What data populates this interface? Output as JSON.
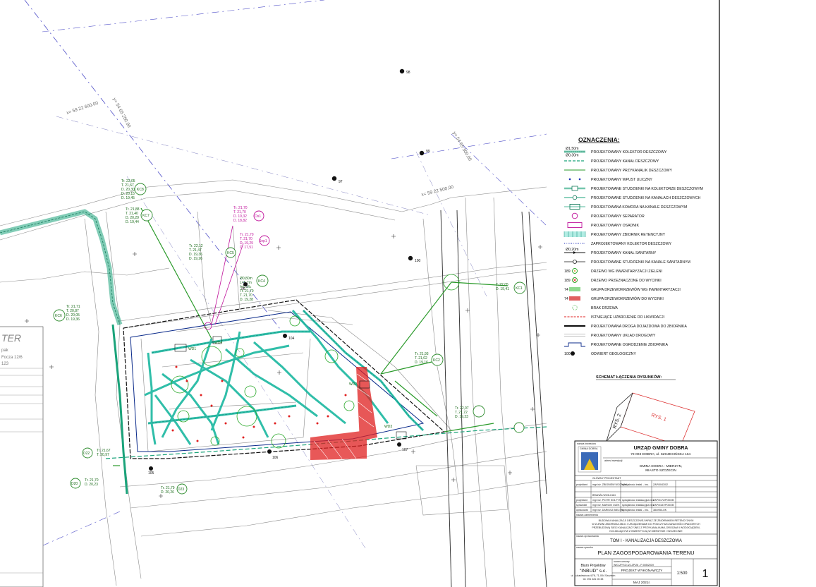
{
  "legend": {
    "title": "OZNACZENIA:",
    "items": [
      {
        "symbol": "collector",
        "top": "Ø1,50m",
        "bottom": "Ø0,30m",
        "label": "PROJEKTOWANY KOLEKTOR DESZCZOWY"
      },
      {
        "symbol": "channel",
        "label": "PROJEKTOWANY KANAŁ DESZCZOWY"
      },
      {
        "symbol": "connector",
        "label": "PROJEKTOWANY PRZYKANALIK DESZCZOWY"
      },
      {
        "symbol": "inlet",
        "label": "PROJEKTOWANY WPUST ULICZNY"
      },
      {
        "symbol": "well-collector",
        "label": "PROJEKTOWANE STUDZIENKI NA KOLEKTORZE DESZCZOWYM"
      },
      {
        "symbol": "well-channel",
        "label": "PROJEKTOWANE STUDZIENKI NA KANAŁACH DESZCZOWYCH"
      },
      {
        "symbol": "chamber",
        "label": "PROJEKTOWANA KOMORA NA KANALE DESZCZOWYM"
      },
      {
        "symbol": "separator",
        "label": "PROJEKTOWANY SEPARATOR"
      },
      {
        "symbol": "settler",
        "label": "PROJEKTOWANY OSADNIK"
      },
      {
        "symbol": "tank",
        "label": "PROJEKTOWANY ZBIORNIK RETENCYJNY"
      },
      {
        "symbol": "designed-collector",
        "label": "ZAPROJEKTOWANY KOLEKTOR DESZCZOWY"
      },
      {
        "symbol": "sanitary",
        "top": "Ø0,20m",
        "label": "PROJEKTOWANY KANAŁ SANITARNY"
      },
      {
        "symbol": "sanitary-well",
        "label": "PROJEKTOWANE STUDZIENKI NA KANALE SANITARNYM"
      },
      {
        "symbol": "tree",
        "num": "189",
        "label": "DRZEWO WG INWENTARYZACJI ZIELENI"
      },
      {
        "symbol": "tree-cut",
        "num": "189",
        "label": "DRZEWO PRZEZNACZONE DO WYCINKI"
      },
      {
        "symbol": "shrub",
        "num": "74",
        "label": "GRUPA DRZEWOKRZEWÓW WG INWENTARYZACJI"
      },
      {
        "symbol": "shrub-cut",
        "num": "74",
        "label": "GRUPA DRZEWOKRZEWÓW DO WYCINKI"
      },
      {
        "symbol": "no-tree",
        "label": "BRAK DRZEWA"
      },
      {
        "symbol": "to-remove",
        "label": "ISTNIEJĄCE UZBROJENIE DO LIKWIDACJI"
      },
      {
        "symbol": "road",
        "label": "PROJEKTOWANA DROGA DOJAZDOWA DO ZBIORNIKA"
      },
      {
        "symbol": "road-layout",
        "label": "PROJEKTOWANY UKŁAD DROGOWY"
      },
      {
        "symbol": "fence",
        "label": "PROJEKTOWANE OGRODZENIE ZBIORNIKA"
      },
      {
        "symbol": "geo",
        "num": "100",
        "label": "ODWIERT GEOLOGICZNY"
      }
    ]
  },
  "schemat": {
    "title": "SCHEMAT ŁĄCZENIA RYSUNKÓW:",
    "rys1": "RYS. 1",
    "rys2": "RYS. 2"
  },
  "title_block": {
    "investor_label": "nazwa inwestora",
    "logo_text": "GMINA DOBRA",
    "investor_name": "URZĄD GMINY DOBRA",
    "investor_address": "72-003 DOBRA; ul. SZCZECIŃSKA 16A",
    "object_label": "adres inwestycji",
    "location_1": "GMINA DOBRA - MIERZYN,",
    "location_2": "MIASTO SZCZECIN",
    "main_designer_header": "GŁÓWNY PROJEKTANT",
    "main_role": "projektant",
    "main_name": "mgr inż. ZBIGNIEW WOŹNIAK",
    "main_spec": "specjalność instal. - ins.",
    "main_no": "ZAP/0043/02",
    "branch": "BRANŻA WOD-KAN",
    "d1_role": "projektant",
    "d1_name": "mgr inż. PIOTR SOŁTYS",
    "d1_spec": "specjalność instalacyjna bez",
    "d1_no": "ZAP/0172/PO0OB",
    "d2_role": "sprawdził",
    "d2_name": "mgr inż. MARCIN OLEK",
    "d2_spec": "specjalność instalacyjna bez",
    "d2_no": "ZAP/0187/PO0OB",
    "d3_role": "opracował",
    "d3_name": "mgr inż. DARIUSZ BIELSKI",
    "d3_spec": "specjalność instal. - ins.",
    "d3_no": "384/95/LOK",
    "task_label": "nazwa zamierzenia",
    "task_line_1": "BUDOWA KANALIZACJI DESZCZOWEJ WRAZ ZE ZBIORNIKIEM RETENCYJNYM",
    "task_line_2": "W ZLEWNI ZBIORNIKA ZB-01 I URZĄDZENIAMI DO PODCZYSZCZANIA WÓD OPADOWYCH",
    "task_line_3": "PRZEBUDOWĄ SIECI KANALIZACYJNEJ Z PRZYKANALIKAMI, DROGAMI I WODOCIĄGIEM,",
    "task_line_4": "KOLIDUJĄCYMI Z INWESTYCJĄ W MIERZYNIE I SZCZECINIE",
    "volume_label": "nazwa opracowania",
    "tom": "TOM I - KANALIZACJA DESZCZOWA",
    "drawing_label": "nazwa rysunku",
    "drawing": "PLAN ZAGOSPODAROWANIA TERENU",
    "office_1": "Biuro Projektów",
    "office_2": "\"INBUD\" s.c.",
    "office_3": "ul. Łukasiewicza 4/78, 71-004 Szczecin",
    "office_4": "tel. 091 481 06 38",
    "number_label": "numer umowy",
    "number_1": "WIG.ZP.SO.3/2.ZP/26 - P-005/2019",
    "stage": "PROJEKT WYKONAWCZY",
    "date": "MAJ 2021r.",
    "scale": "1:500",
    "sheet": "1"
  },
  "map_labels": {
    "coord_1": "x= 59 22 600.00",
    "coord_2": "y= 54 65 250.00",
    "coord_3": "y= 54 65 300.00",
    "coord_4": "x= 59 22 500.00",
    "geo_98": "98",
    "geo_99": "99",
    "geo_97": "97",
    "geo_100": "100",
    "geo_96": "96",
    "geo_104": "104",
    "geo_105": "105",
    "geo_106": "106",
    "geo_107": "107",
    "kc1": "KC1",
    "kc2": "KC2",
    "kc4": "KC4",
    "kc5": "KC5",
    "kc6": "KC6",
    "kc7": "KC7",
    "kc8": "KC8",
    "os1": "Os1",
    "sep1": "Sep1",
    "wd1": "WD1",
    "wd2": "WD2",
    "wd3": "WD3",
    "wd4": "WD4",
    "d20": "D20",
    "d22": "D22",
    "d23": "D23",
    "lbl_kc8": "Tr. 22,05\nT. 21,67\nD. 20,30\nD. 20,15\nD. 19,45",
    "lbl_kc7": "Tr. 21,88\nT. 21,40\nD. 20,29\nD. 19,44",
    "lbl_kc5": "Tr. 22,12\nT. 21,47\nD. 19,36\nD. 19,26",
    "lbl_os1": "Tr. 21,70\nT. 21,70\nD. 19,32\nD. 18,82",
    "lbl_sep1": "Tr. 21,70\nT. 21,70\nD. 19,29\nD. 17,51",
    "lbl_kc4": "Ø0,80m\nL=5,7m\nI=1,5‰\nTr. 21,70\nT. 21,70\nD. 19,28",
    "lbl_kc6": "Tr. 21,71\nT. 20,87\nD. 20,05\nD. 19,36",
    "lbl_kc1": "T. 22,05\nD. 19,41",
    "lbl_kc2": "Tr. 21,93\nT. 21,02\nD. 19,16",
    "lbl_kc3": "Tr. 22,07\nT. 21,72\nD. 19,23",
    "lbl_d22": "Tr. 21,67\nT. 20,97",
    "lbl_d20": "Tr. 21,70\nD. 20,23",
    "lbl_d23": "Tr. 21,79\nD. 20,26",
    "side_1": "TER",
    "side_2": "pak",
    "side_3": "Focza 12/6",
    "side_4": "123"
  }
}
